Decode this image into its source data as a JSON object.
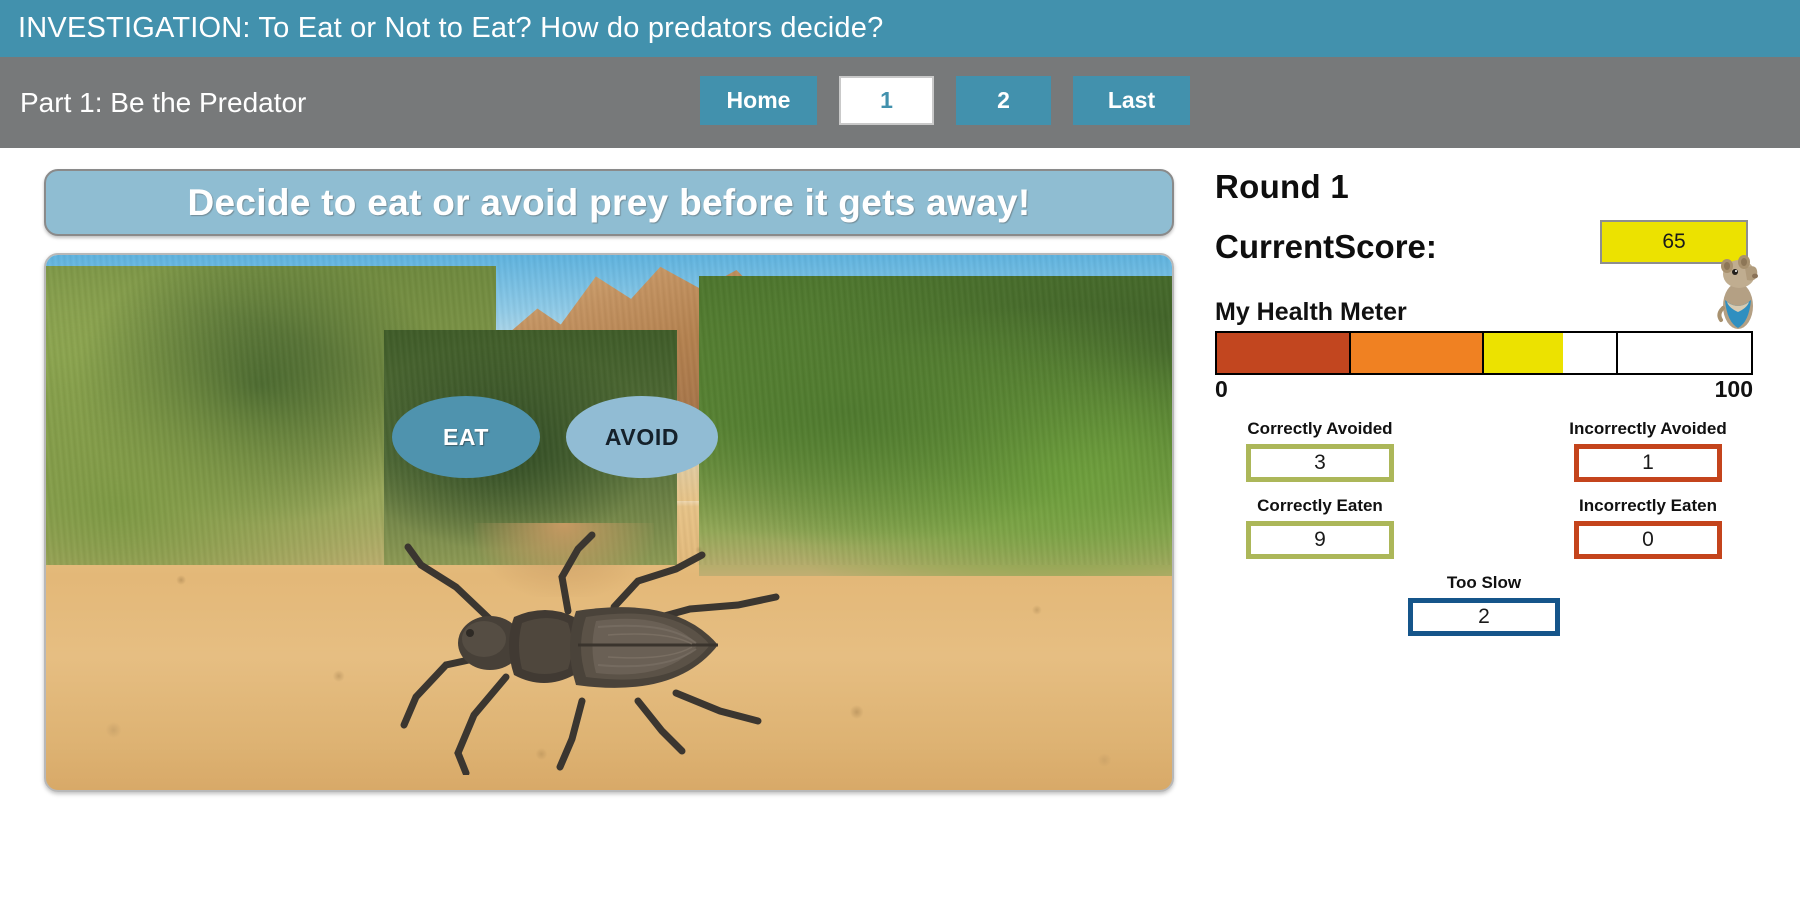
{
  "header": {
    "title": "INVESTIGATION: To Eat or Not to Eat? How do predators decide?",
    "bg_color": "#4291ad"
  },
  "subnav": {
    "part_label": "Part 1: Be the Predator",
    "bg_color": "#77797a",
    "buttons": [
      {
        "label": "Home",
        "active": false
      },
      {
        "label": "1",
        "active": true
      },
      {
        "label": "2",
        "active": false
      },
      {
        "label": "Last",
        "active": false
      }
    ]
  },
  "main": {
    "prompt": "Decide to eat or avoid prey before it gets away!",
    "prompt_bg": "#8fbdd2",
    "decision_buttons": [
      {
        "label": "EAT",
        "bg": "#4f93ae",
        "text_color": "#ffffff"
      },
      {
        "label": "AVOID",
        "bg": "#91bcd4",
        "text_color": "#15212b"
      }
    ],
    "scene_alt": "beetle-on-sand-photo"
  },
  "sidebar": {
    "round_label": "Round 1",
    "score_label": "CurrentScore:",
    "score_value": "65",
    "score_box_color": "#ece200",
    "health_title": "My Health Meter",
    "health_scale_min": "0",
    "health_scale_max": "100",
    "health_value": 65,
    "health_segments": [
      {
        "color": "#c2461f",
        "filled": 100
      },
      {
        "color": "#f08122",
        "filled": 100
      },
      {
        "color": "#ece200",
        "filled": 60
      },
      {
        "color": "#ffffff",
        "filled": 0
      }
    ],
    "stats": [
      {
        "label": "Correctly Avoided",
        "value": "3",
        "border": "#acb759",
        "style": "olive"
      },
      {
        "label": "Incorrectly Avoided",
        "value": "1",
        "border": "#c4441c",
        "style": "red"
      },
      {
        "label": "Correctly Eaten",
        "value": "9",
        "border": "#acb759",
        "style": "olive"
      },
      {
        "label": "Incorrectly Eaten",
        "value": "0",
        "border": "#c4441c",
        "style": "red"
      },
      {
        "label": "Too Slow",
        "value": "2",
        "border": "#15558a",
        "style": "blue"
      }
    ]
  }
}
